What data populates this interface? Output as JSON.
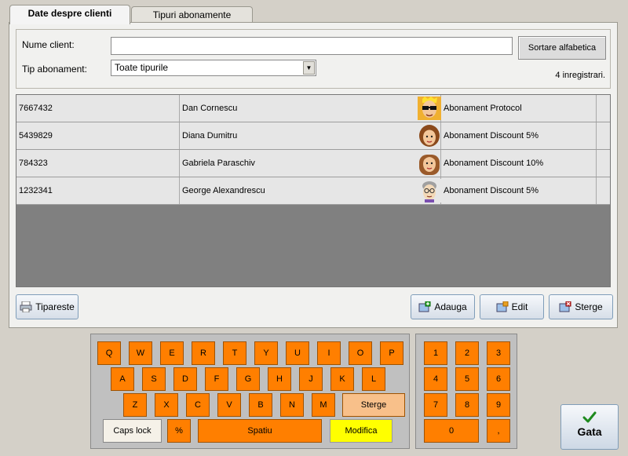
{
  "tabs": [
    {
      "label": "Date despre clienti",
      "active": true
    },
    {
      "label": "Tipuri abonamente",
      "active": false
    }
  ],
  "filter": {
    "name_label": "Nume client:",
    "name_value": "",
    "type_label": "Tip abonament:",
    "type_value": "Toate tipurile",
    "sort_button": "Sortare alfabetica",
    "record_count": "4 inregistrari."
  },
  "clients": [
    {
      "id": "7667432",
      "name": "Dan Cornescu",
      "avatar": "avatar-sunglasses-icon",
      "subscription": "Abonament Protocol"
    },
    {
      "id": "5439829",
      "name": "Diana Dumitru",
      "avatar": "avatar-woman-icon",
      "subscription": "Abonament Discount 5%"
    },
    {
      "id": "784323",
      "name": "Gabriela Paraschiv",
      "avatar": "avatar-woman-long-hair-icon",
      "subscription": "Abonament Discount 10%"
    },
    {
      "id": "1232341",
      "name": "George Alexandrescu",
      "avatar": "avatar-elderly-man-icon",
      "subscription": "Abonament Discount 5%"
    }
  ],
  "actions": {
    "print": "Tipareste",
    "add": "Adauga",
    "edit": "Edit",
    "delete": "Sterge"
  },
  "keyboard": {
    "row1": [
      "Q",
      "W",
      "E",
      "R",
      "T",
      "Y",
      "U",
      "I",
      "O",
      "P"
    ],
    "row2": [
      "A",
      "S",
      "D",
      "F",
      "G",
      "H",
      "J",
      "K",
      "L"
    ],
    "row3": [
      "Z",
      "X",
      "C",
      "V",
      "B",
      "N",
      "M"
    ],
    "backspace": "Sterge",
    "caps": "Caps lock",
    "percent": "%",
    "space": "Spatiu",
    "modify": "Modifica"
  },
  "numpad": {
    "keys": [
      "1",
      "2",
      "3",
      "4",
      "5",
      "6",
      "7",
      "8",
      "9"
    ],
    "zero": "0",
    "comma": ","
  },
  "done_button": "Gata",
  "colors": {
    "key_orange": "#ff7f00",
    "key_light": "#f8c08a",
    "modify_yellow": "#ffff00",
    "grid_empty": "#808080"
  }
}
